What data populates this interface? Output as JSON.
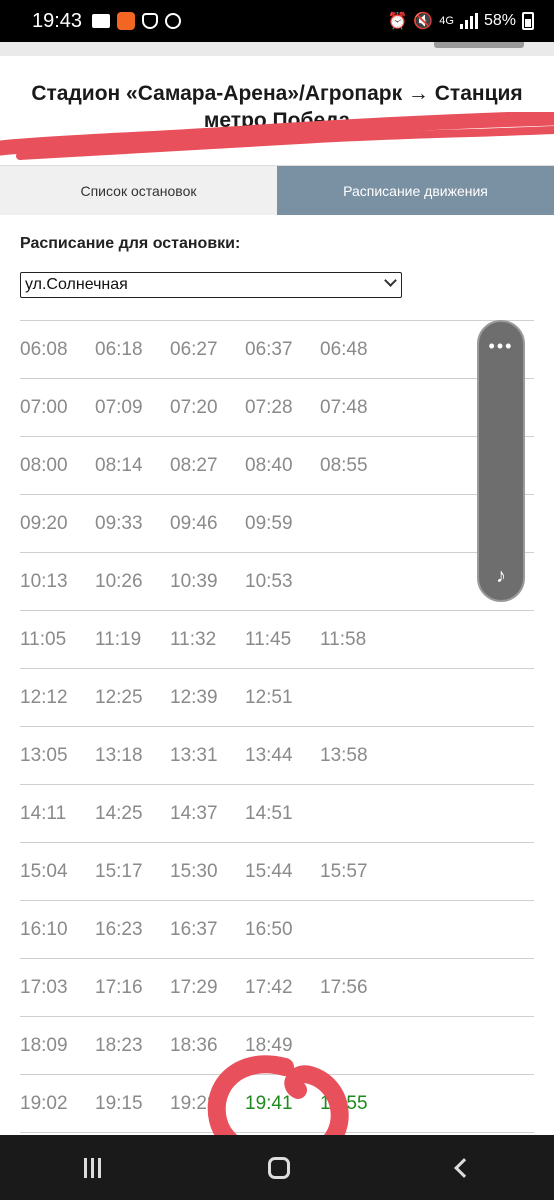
{
  "status_bar": {
    "time": "19:43",
    "network": "4G",
    "battery": "58%"
  },
  "route_title": "Стадион «Самара-Арена»/Агропарк → Станция метро Победа",
  "tabs": [
    {
      "label": "Список остановок",
      "active": false
    },
    {
      "label": "Расписание движения",
      "active": true
    }
  ],
  "schedule_label": "Расписание для остановки:",
  "stop_select": {
    "value": "ул.Солнечная"
  },
  "schedule": [
    [
      "06:08",
      "06:18",
      "06:27",
      "06:37",
      "06:48"
    ],
    [
      "07:00",
      "07:09",
      "07:20",
      "07:28",
      "07:48"
    ],
    [
      "08:00",
      "08:14",
      "08:27",
      "08:40",
      "08:55"
    ],
    [
      "09:20",
      "09:33",
      "09:46",
      "09:59"
    ],
    [
      "10:13",
      "10:26",
      "10:39",
      "10:53"
    ],
    [
      "11:05",
      "11:19",
      "11:32",
      "11:45",
      "11:58"
    ],
    [
      "12:12",
      "12:25",
      "12:39",
      "12:51"
    ],
    [
      "13:05",
      "13:18",
      "13:31",
      "13:44",
      "13:58"
    ],
    [
      "14:11",
      "14:25",
      "14:37",
      "14:51"
    ],
    [
      "15:04",
      "15:17",
      "15:30",
      "15:44",
      "15:57"
    ],
    [
      "16:10",
      "16:23",
      "16:37",
      "16:50"
    ],
    [
      "17:03",
      "17:16",
      "17:29",
      "17:42",
      "17:56"
    ],
    [
      "18:09",
      "18:23",
      "18:36",
      "18:49"
    ],
    [
      "19:02",
      "19:15",
      "19:28",
      "19:41",
      "19:55"
    ]
  ],
  "highlighted_times": [
    "19:41",
    "19:55"
  ],
  "colors": {
    "active_tab": "#7a90a3",
    "past_time": "#8a8a8a",
    "upcoming_time": "#1d8a1d",
    "marker": "#e8505b"
  }
}
